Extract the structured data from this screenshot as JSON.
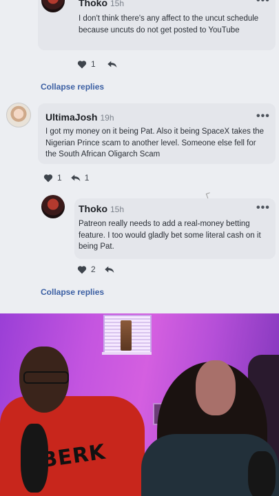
{
  "comments": [
    {
      "author": "Thoko",
      "time": "15h",
      "text": "I don't think there's any affect to the uncut schedule because uncuts do not get posted to YouTube",
      "likes": "1",
      "more_icon": "more-icon"
    },
    {
      "author": "UltimaJosh",
      "time": "19h",
      "text": "I got my money on it being Pat. Also it being SpaceX takes the Nigerian Prince scam to another level. Someone else fell for the South African Oligarch Scam",
      "likes": "1",
      "replies": "1",
      "more_icon": "more-icon"
    },
    {
      "author": "Thoko",
      "time": "15h",
      "text": "Patreon really needs to add a real-money betting feature. I too would gladly bet some literal cash on it being Pat.",
      "likes": "2",
      "more_icon": "more-icon"
    }
  ],
  "collapse_label_1": "Collapse replies",
  "collapse_label_2": "Collapse replies",
  "jersey_text": "BERK",
  "colors": {
    "link": "#3b5fa3",
    "card": "#e4e6eb",
    "video_bg": "#c455e0"
  }
}
